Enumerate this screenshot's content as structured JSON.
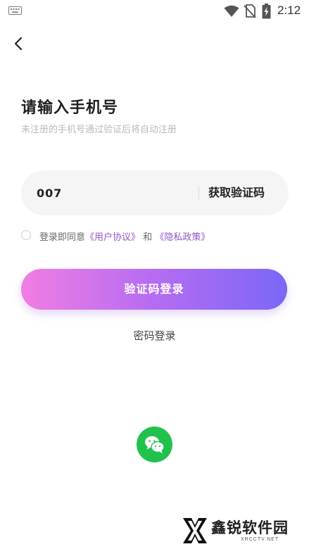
{
  "status_bar": {
    "time": "2:12",
    "icons": [
      "keyboard-icon",
      "wifi-icon",
      "no-sim-icon",
      "battery-charging-icon"
    ]
  },
  "header": {
    "back_icon": "chevron-left-icon"
  },
  "login": {
    "title": "请输入手机号",
    "subtitle": "未注册的手机号通过验证后将自动注册",
    "phone_value": "007",
    "phone_placeholder": "",
    "get_code_label": "获取验证码",
    "agree_prefix": "登录即同意",
    "user_agreement": "《用户协议》",
    "agree_and": "和",
    "privacy_policy": "《隐私政策》",
    "agreed": false,
    "submit_label": "验证码登录",
    "password_login_label": "密码登录",
    "wechat_icon": "wechat-icon"
  },
  "colors": {
    "gradient_start": "#f17de3",
    "gradient_end": "#7b67f6",
    "link": "#8e56c6",
    "wechat_green": "#20c24b"
  },
  "watermark": {
    "name": "鑫锐软件园",
    "domain": "XRCCTV.NET"
  }
}
